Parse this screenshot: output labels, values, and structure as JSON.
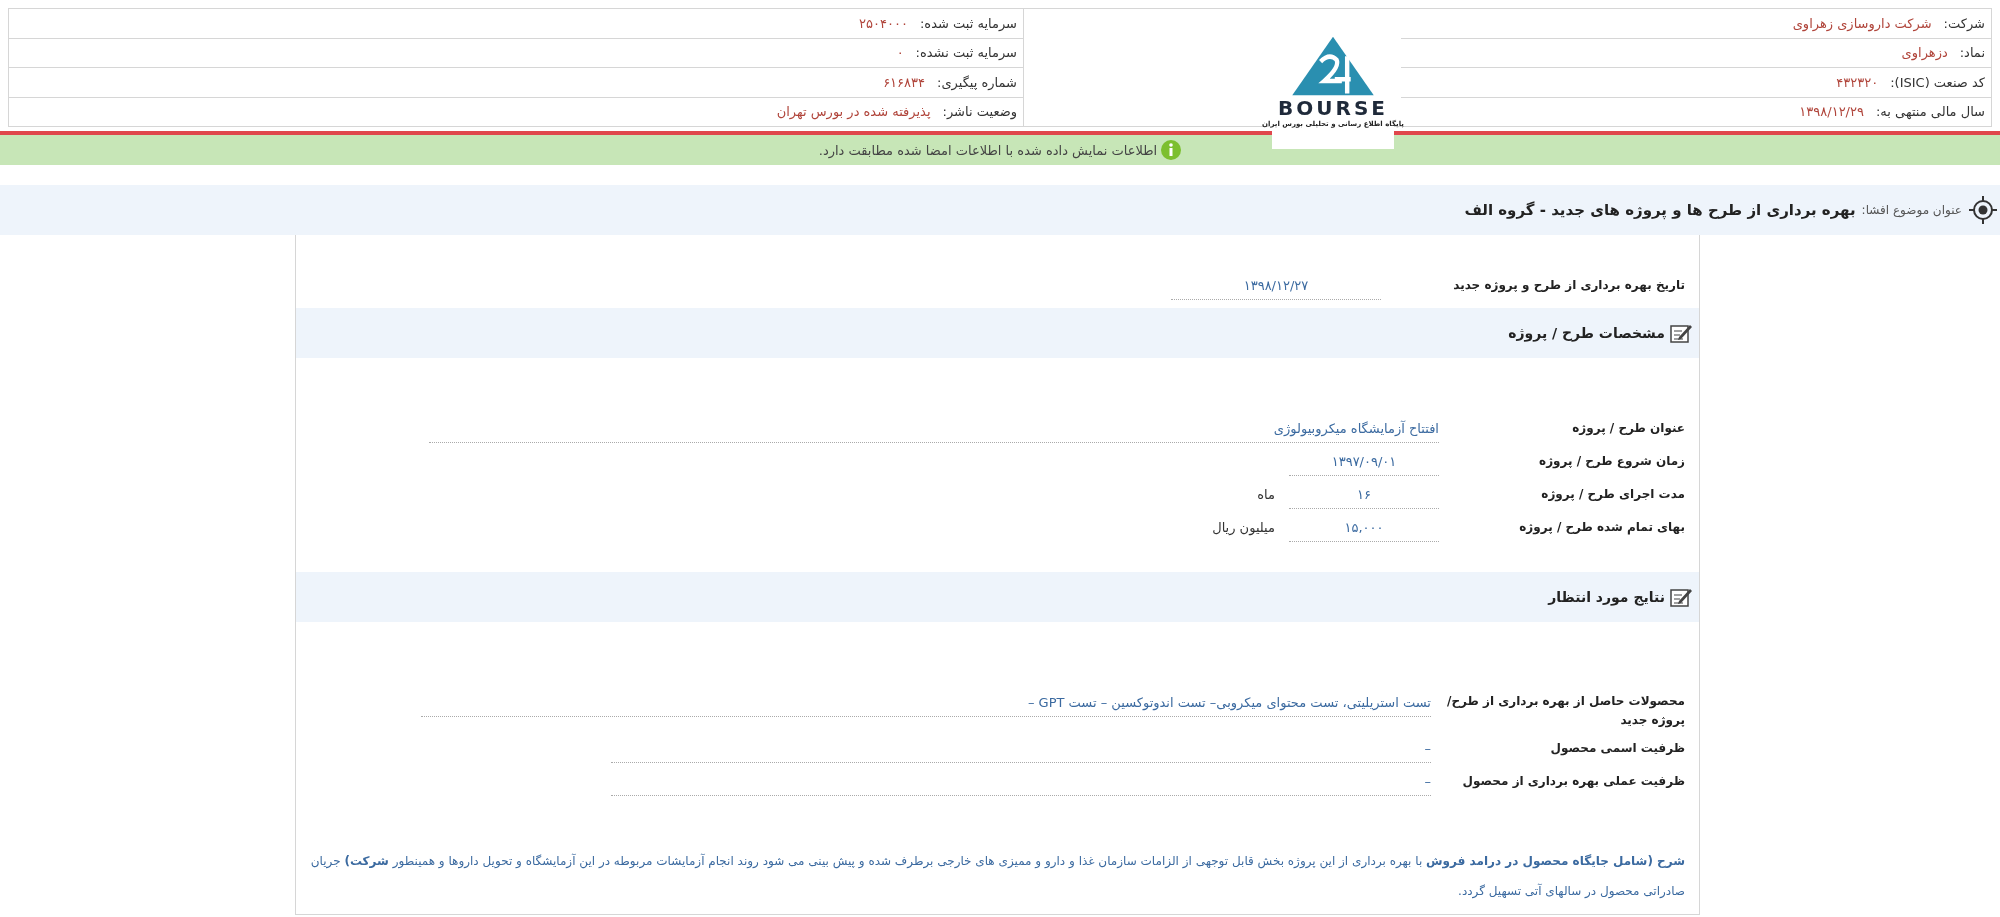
{
  "header": {
    "right_rows": [
      {
        "label": "شرکت:",
        "value": "شرکت داروسازی زهراوی"
      },
      {
        "label": "نماد:",
        "value": "دزهراوی"
      },
      {
        "label": "کد صنعت (ISIC):",
        "value": "۴۳۲۳۲۰"
      },
      {
        "label": "سال مالی منتهی به:",
        "value": "۱۳۹۸/۱۲/۲۹"
      }
    ],
    "logo": {
      "wordmark": "BOURSE",
      "tagline": "پایگاه اطلاع رسانی و تحلیلی بورس ایران"
    },
    "left_rows": [
      {
        "label": "سرمایه ثبت شده:",
        "value": "۲۵۰۴۰۰۰"
      },
      {
        "label": "سرمایه ثبت نشده:",
        "value": "۰"
      },
      {
        "label": "شماره پیگیری:",
        "value": "۶۱۶۸۳۴"
      },
      {
        "label": "وضعیت ناشر:",
        "value": "پذیرفته شده در بورس تهران"
      }
    ]
  },
  "notice": "اطلاعات نمایش داده شده با اطلاعات امضا شده مطابقت دارد.",
  "disclosure": {
    "label": "عنوان موضوع افشا:",
    "title": "بهره برداری از طرح ها و پروژه های جدید - گروه الف"
  },
  "date_field": {
    "label": "تاریخ بهره برداری از طرح و پروژه جدید",
    "value": "۱۳۹۸/۱۲/۲۷"
  },
  "sections": [
    {
      "title": "مشخصات طرح / پروژه",
      "fields": [
        {
          "kind": "wide",
          "label": "عنوان طرح / پروژه",
          "value": "افتتاح آزمایشگاه میکروبیولوژی"
        },
        {
          "kind": "short",
          "label": "زمان شروع طرح / پروژه",
          "value": "۱۳۹۷/۰۹/۰۱"
        },
        {
          "kind": "short",
          "label": "مدت اجرای طرح / پروژه",
          "value": "۱۶",
          "unit": "ماه"
        },
        {
          "kind": "short",
          "label": "بهای تمام شده طرح / پروژه",
          "value": "۱۵,۰۰۰",
          "unit": "میلیون ریال"
        }
      ]
    },
    {
      "title": "نتایج مورد انتظار",
      "fields": [
        {
          "kind": "wide",
          "label": "محصولات حاصل از بهره برداری از طرح/ پروژه جدید",
          "value": "تست استریلیتی، تست محتوای میکروبی– تست اندوتوکسین – تست GPT –"
        },
        {
          "kind": "mid",
          "label": "ظرفیت اسمی محصول",
          "value": "–"
        },
        {
          "kind": "mid",
          "label": "ظرفیت عملی بهره برداری از محصول",
          "value": "–"
        }
      ]
    }
  ],
  "description": "**شرح (شامل جایگاه محصول در درامد فروش** با بهره برداری از این پروژه بخش قابل توجهی از الزامات سازمان غذا و دارو و ممیزی های خارجی برطرف شده و پیش بینی می شود روند انجام آزمایشات مربوطه در این آزمایشگاه و تحویل داروها و همینطور **شرکت)** جریان صادراتی محصول در سالهای آتی تسهیل گردد."
}
